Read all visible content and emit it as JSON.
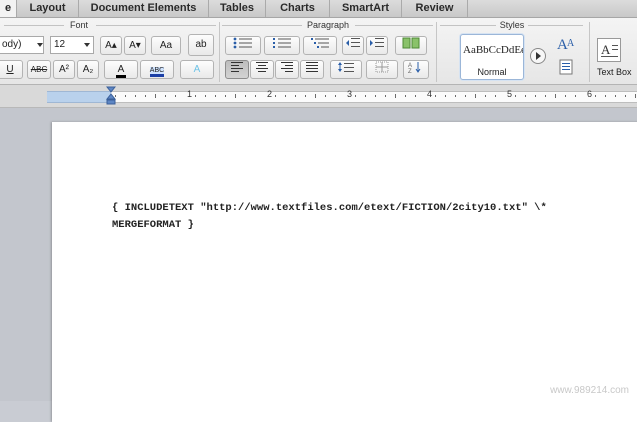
{
  "tabs": [
    "e",
    "Layout",
    "Document Elements",
    "Tables",
    "Charts",
    "SmartArt",
    "Review"
  ],
  "groups": {
    "font": "Font",
    "paragraph": "Paragraph",
    "styles": "Styles"
  },
  "font": {
    "name": "ody)",
    "size": "12",
    "grow": "A▴",
    "shrink": "A▾",
    "change_case": "Aa",
    "clear": "ab",
    "underline": "U",
    "strikethrough": "ABC",
    "superscript": "A²",
    "subscript": "A₂",
    "font_color": "A",
    "highlight": "ABC",
    "text_effects": "A"
  },
  "styles": {
    "sample": "AaBbCcDdEe",
    "name": "Normal",
    "text_box": "Text Box"
  },
  "ruler": {
    "labels": [
      "1",
      "2",
      "3",
      "4",
      "5",
      "6"
    ]
  },
  "document": {
    "field_code": "{ INCLUDETEXT \"http://www.textfiles.com/etext/FICTION/2city10.txt\" \\*\nMERGEFORMAT }"
  },
  "watermark": "www.989214.com"
}
